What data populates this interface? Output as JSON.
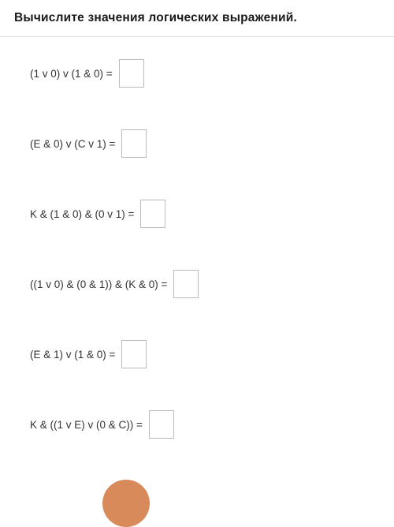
{
  "header": {
    "title": "Вычислите значения логических выражений."
  },
  "problems": [
    {
      "expression": "(1 v 0) v (1 & 0) =",
      "answer": ""
    },
    {
      "expression": "(E & 0) v (C v 1) =",
      "answer": ""
    },
    {
      "expression": "K & (1 & 0) & (0 v 1) =",
      "answer": ""
    },
    {
      "expression": "((1 v 0) & (0 & 1)) & (K & 0) =",
      "answer": ""
    },
    {
      "expression": "(E & 1) v (1 & 0) =",
      "answer": ""
    },
    {
      "expression": "K & ((1 v E) v (0 & C)) =",
      "answer": ""
    }
  ]
}
